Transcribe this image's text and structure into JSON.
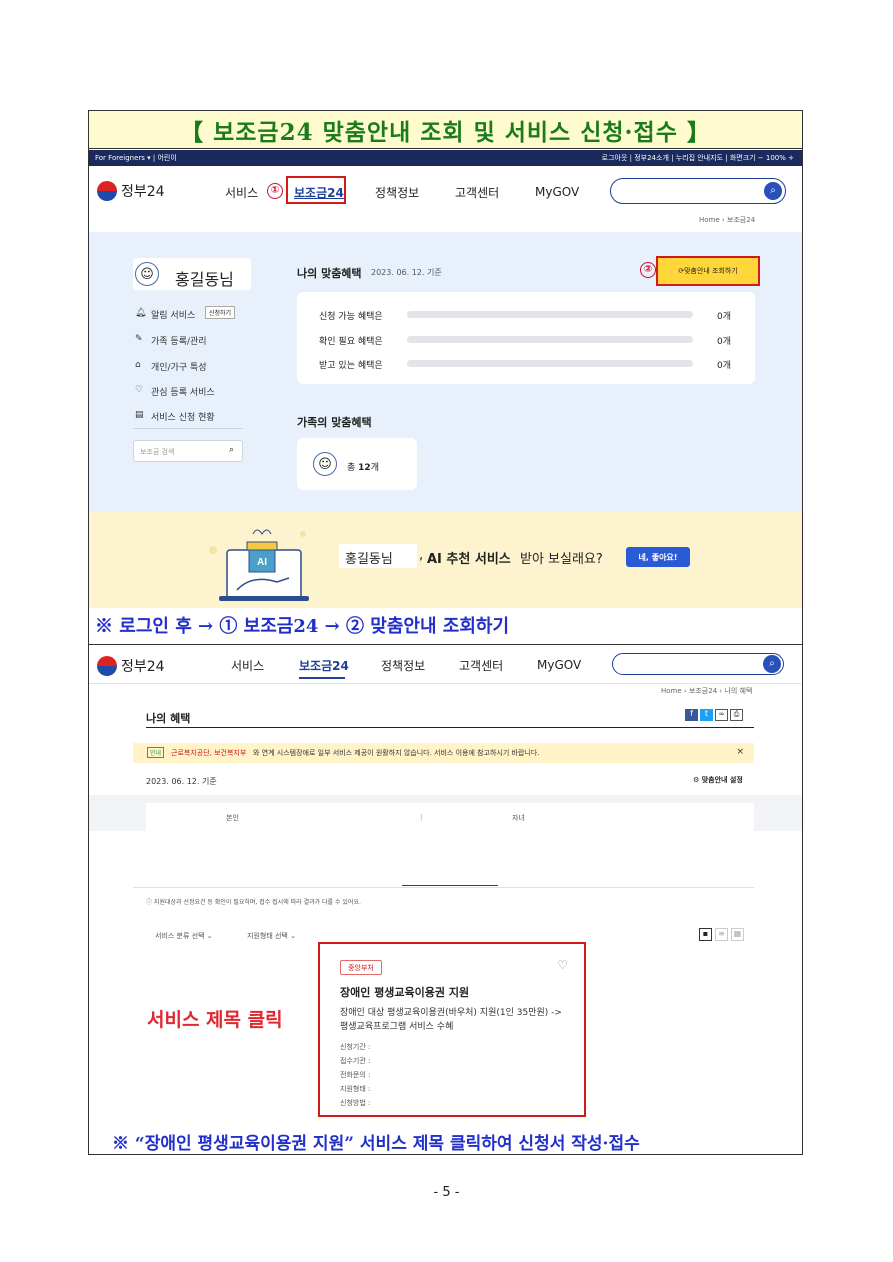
{
  "title": "【 보조금24 맞춤안내 조회 및 서비스 신청·접수 】",
  "shot1": {
    "topbar_left": "For Foreigners ▾  |  어린이",
    "topbar_right": "로그아웃 | 정부24소개 | 누리집 안내지도 | 화면크기 − 100% +",
    "logo": "정부24",
    "nav": [
      "서비스",
      "보조금24",
      "정책정보",
      "고객센터",
      "MyGOV"
    ],
    "marker1": "①",
    "marker2": "②",
    "breadcrumb": "Home › 보조금24",
    "user_name": "홍길동님",
    "side_menu": [
      "알림 서비스",
      "가족 등록/관리",
      "개인/가구 특성",
      "관심 등록 서비스",
      "서비스 신청 현황"
    ],
    "alarm_badge": "신청하기",
    "search_placeholder": "보조금 검색",
    "my_benefits_title": "나의 맞춤혜택",
    "my_benefits_date": "2023. 06. 12. 기준",
    "lookup_button": "맞춤안내 조회하기",
    "benefit_rows": [
      {
        "label": "신청 가능 혜택은",
        "value": "0개"
      },
      {
        "label": "확인 필요 혜택은",
        "value": "0개"
      },
      {
        "label": "받고 있는 혜택은",
        "value": "0개"
      }
    ],
    "family_title": "가족의 맞춤혜택",
    "family_total_prefix": "총",
    "family_total_count": "12",
    "family_total_suffix": "개",
    "ai_name": "홍길동님",
    "ai_sep": ",",
    "ai_bold": "AI 추천 서비스",
    "ai_rest": "받아 보실래요?",
    "ai_button": "네, 좋아요!",
    "ai_icon_label": "AI"
  },
  "note1": "※ 로그인 후 → ① 보조금24 → ② 맞춤안내 조회하기",
  "shot2": {
    "logo": "정부24",
    "nav": [
      "서비스",
      "보조금24",
      "정책정보",
      "고객센터",
      "MyGOV"
    ],
    "breadcrumb": "Home › 보조금24 › 나의 혜택",
    "page_title": "나의 혜택",
    "notice_tag": "안내",
    "notice_highlight": "근로복지공단, 보건복지부",
    "notice_text": "와 연계 시스템장애로 일부 서비스 제공이 원활하지 않습니다. 서비스 이용에 참고하시기 바랍니다.",
    "date": "2023. 06. 12. 기준",
    "settings": "맞춤안내 설정",
    "tabs": [
      "본인",
      "자녀"
    ],
    "info_text": "지원대상과 선정요건 등 확인이 필요하며, 접수 접시에 따라 결과가 다를 수 있어요.",
    "filters": [
      "서비스 분류 선택",
      "지원형태 선택"
    ],
    "card": {
      "tag": "중앙부처",
      "title": "장애인 평생교육이용권 지원",
      "desc": "장애인 대상 평생교육이용권(바우처) 지원(1인 35만원) -> 평생교육프로그램 서비스 수혜",
      "fields": [
        "신청기간 :",
        "접수기관 :",
        "전화문의 :",
        "지원형태 :",
        "신청방법 :"
      ]
    },
    "red_label": "서비스 제목 클릭"
  },
  "note2": "※ “장애인 평생교육이용권 지원” 서비스 제목 클릭하여 신청서 작성·접수",
  "page_number": "- 5 -",
  "colors": {
    "title_green": "#1b7b1b",
    "note_blue": "#2230c9",
    "highlight_red": "#d01b1b",
    "title_bg": "#fefccf"
  }
}
